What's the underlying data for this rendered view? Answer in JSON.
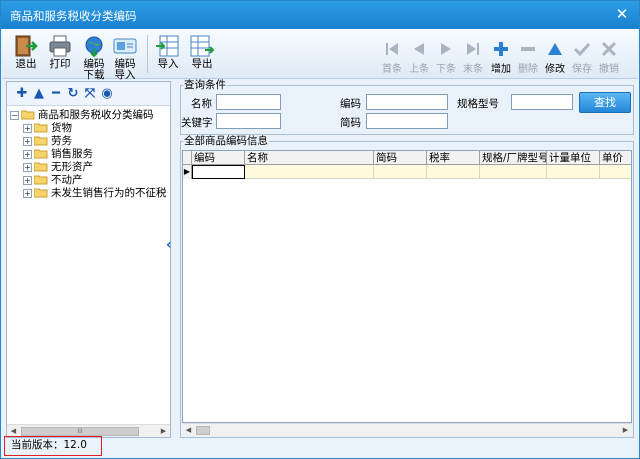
{
  "window": {
    "title": "商品和服务税收分类编码"
  },
  "toolbar": {
    "buttons": [
      {
        "label": "退出",
        "icon": "exit-icon"
      },
      {
        "label": "打印",
        "icon": "printer-icon"
      },
      {
        "label": "编码\n下载",
        "icon": "globe-download-icon"
      },
      {
        "label": "编码\n导入",
        "icon": "card-import-icon"
      },
      {
        "label": "导入",
        "icon": "table-import-icon"
      },
      {
        "label": "导出",
        "icon": "table-export-icon"
      }
    ],
    "nav": [
      {
        "label": "首条",
        "icon": "first-record-icon",
        "enabled": false
      },
      {
        "label": "上条",
        "icon": "previous-record-icon",
        "enabled": false
      },
      {
        "label": "下条",
        "icon": "next-record-icon",
        "enabled": false
      },
      {
        "label": "末条",
        "icon": "last-record-icon",
        "enabled": false
      },
      {
        "label": "增加",
        "icon": "add-icon",
        "enabled": true
      },
      {
        "label": "删除",
        "icon": "delete-icon",
        "enabled": false
      },
      {
        "label": "修改",
        "icon": "edit-icon",
        "enabled": true
      },
      {
        "label": "保存",
        "icon": "save-icon",
        "enabled": false
      },
      {
        "label": "撤销",
        "icon": "undo-icon",
        "enabled": false
      }
    ]
  },
  "tree": {
    "root": "商品和服务税收分类编码",
    "children": [
      "货物",
      "劳务",
      "销售服务",
      "无形资产",
      "不动产",
      "未发生销售行为的不征税"
    ]
  },
  "query": {
    "group_title": "查询条件",
    "name_label": "名称",
    "keyword_label": "关键字",
    "code_label": "编码",
    "short_code_label": "简码",
    "spec_label": "规格型号",
    "search_button": "查找"
  },
  "grid": {
    "group_title": "全部商品编码信息",
    "columns": [
      "编码",
      "名称",
      "简码",
      "税率",
      "规格/厂牌型号",
      "计量单位",
      "单价"
    ]
  },
  "status": {
    "version_text": "当前版本：12.0"
  },
  "colors": {
    "titlebar": "#1a7fd0",
    "search_button": "#2487d7",
    "highlight_border": "#e02020",
    "selected_row": "#fffbdc"
  }
}
